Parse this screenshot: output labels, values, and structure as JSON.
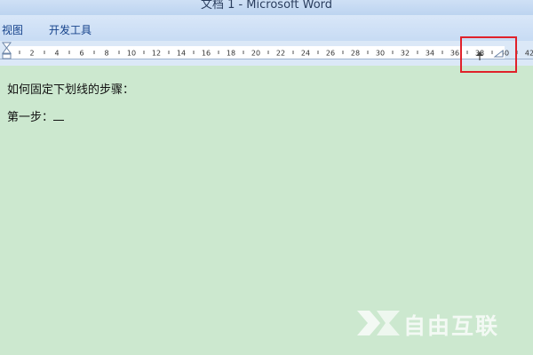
{
  "window": {
    "title": "文档 1 - Microsoft Word"
  },
  "ribbon": {
    "tabs": [
      {
        "label": "视图"
      },
      {
        "label": "开发工具"
      }
    ]
  },
  "ruler": {
    "numbers": [
      2,
      4,
      6,
      8,
      10,
      12,
      14,
      16,
      18,
      20,
      22,
      24,
      26,
      28,
      30,
      32,
      34,
      36,
      38,
      40,
      42
    ],
    "right_indent_marker_value": 40
  },
  "document": {
    "lines": [
      {
        "text": "如何固定下划线的步骤："
      },
      {
        "text": "第一步："
      }
    ]
  },
  "watermark": {
    "text": "自由互联",
    "logo": "x-logo-icon"
  },
  "colors": {
    "page_background": "#cce8cf",
    "ribbon_text": "#15428b",
    "highlight": "#e0212a"
  }
}
